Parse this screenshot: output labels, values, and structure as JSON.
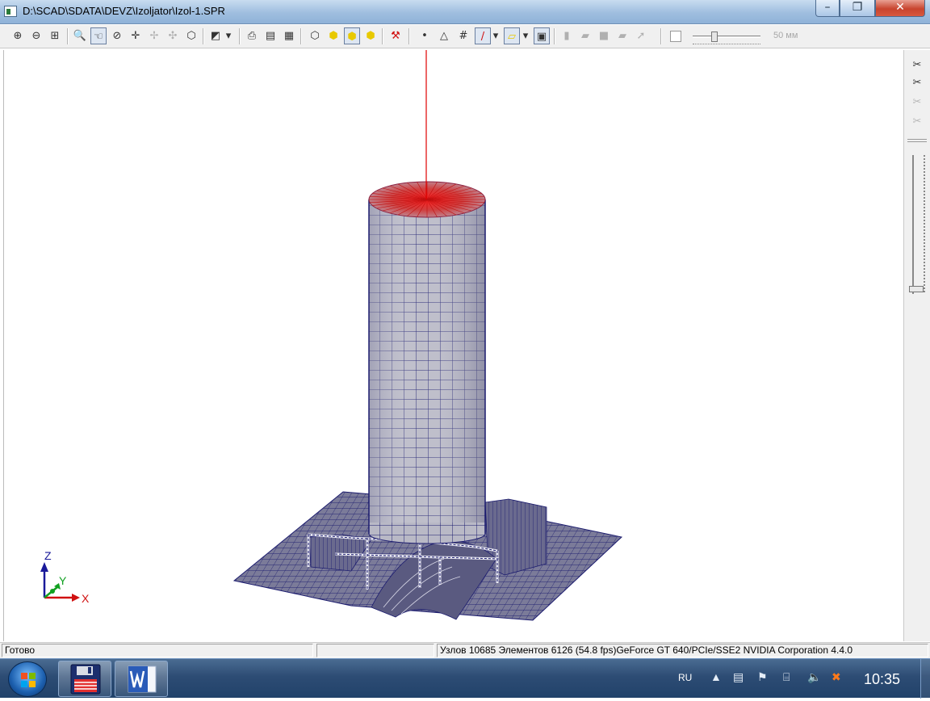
{
  "window": {
    "title": "D:\\SCAD\\SDATA\\DEVZ\\Izoljator\\Izol-1.SPR",
    "minimize_glyph": "–",
    "maximize_glyph": "❐",
    "close_glyph": "✕"
  },
  "toolbar": {
    "zoom_in_icon": "zoom-in-icon",
    "scale_label": "50 мм",
    "slider_level": 0.3
  },
  "axes": {
    "z_label": "Z",
    "y_label": "Y",
    "x_label": "X"
  },
  "statusbar": {
    "ready": "Готово",
    "empty_pane": "",
    "info": "Узлов 10685  Элементов 6126  (54.8 fps)GeForce GT 640/PCIe/SSE2 NVIDIA Corporation 4.4.0"
  },
  "taskbar": {
    "language": "RU",
    "clock": "10:35",
    "apps": [
      "SCAD",
      "Word"
    ]
  },
  "colors": {
    "mesh_fill": "#b9b9c6",
    "mesh_line": "#1b1b6e",
    "load_red": "#e00000",
    "title_gradient": "#9fbedf",
    "taskbar": "#2d4c74"
  }
}
